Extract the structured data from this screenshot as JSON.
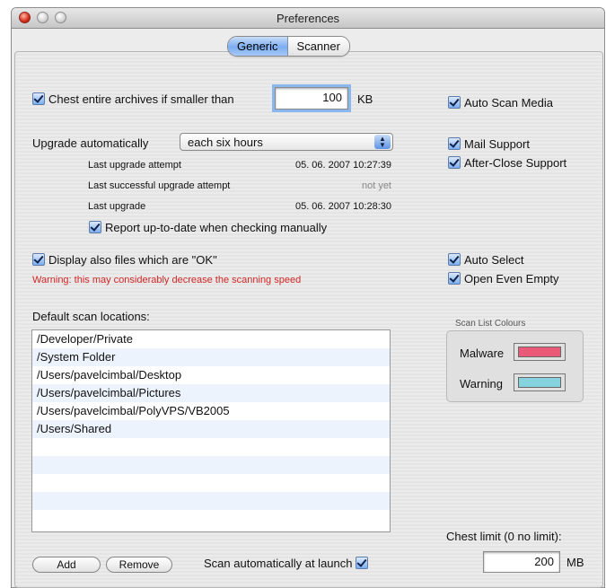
{
  "window": {
    "title": "Preferences"
  },
  "tabs": {
    "generic": "Generic",
    "scanner": "Scanner"
  },
  "archives": {
    "label": "Chest entire archives if smaller than",
    "value": "100",
    "unit": "KB"
  },
  "right_options": {
    "auto_scan_media": "Auto Scan Media",
    "mail_support": "Mail Support",
    "after_close_support": "After-Close Support",
    "auto_select": "Auto Select",
    "open_even_empty": "Open Even Empty"
  },
  "upgrade": {
    "label": "Upgrade automatically",
    "selected": "each six hours",
    "last_attempt_label": "Last upgrade attempt",
    "last_attempt_value": "05. 06. 2007 10:27:39",
    "last_success_label": "Last successful upgrade attempt",
    "last_success_value": "not yet",
    "last_upgrade_label": "Last upgrade",
    "last_upgrade_value": "05. 06. 2007 10:28:30",
    "report_label": "Report up-to-date when checking manually"
  },
  "display_ok": {
    "label": "Display also files which are \"OK\"",
    "warning": "Warning: this may considerably decrease the scanning speed"
  },
  "locations": {
    "label": "Default scan locations:",
    "items": [
      "/Developer/Private",
      "/System Folder",
      "/Users/pavelcimbal/Desktop",
      "/Users/pavelcimbal/Pictures",
      "/Users/pavelcimbal/PolyVPS/VB2005",
      "/Users/Shared"
    ]
  },
  "colours": {
    "title": "Scan List Colours",
    "malware_label": "Malware",
    "warning_label": "Warning",
    "malware_color": "#e85a78",
    "warning_color": "#86d3e0"
  },
  "buttons": {
    "add": "Add",
    "remove": "Remove"
  },
  "scan_at_launch": "Scan automatically at launch",
  "chest_limit": {
    "label": "Chest limit (0 no limit):",
    "value": "200",
    "unit": "MB"
  }
}
